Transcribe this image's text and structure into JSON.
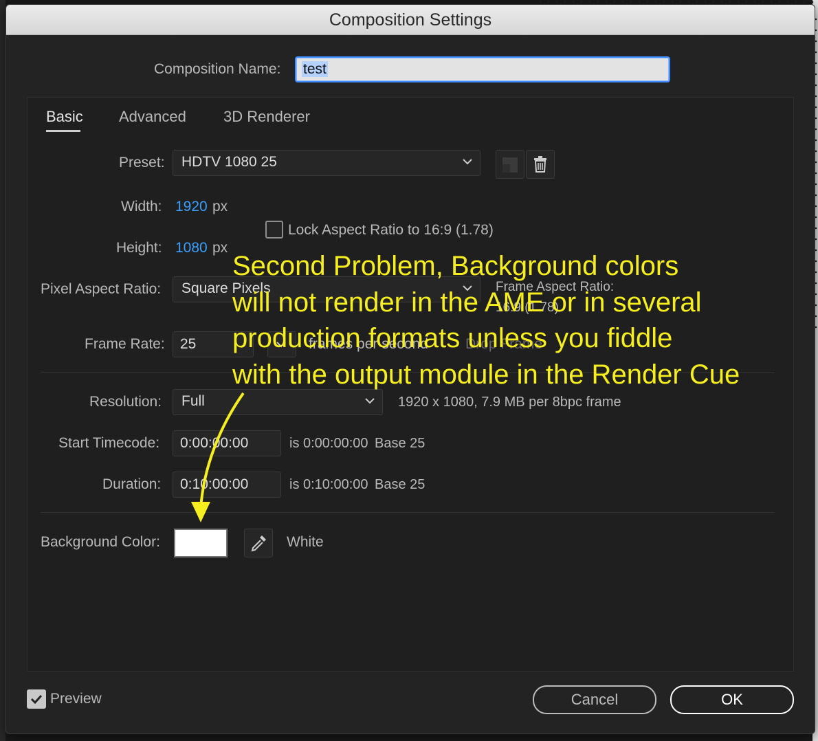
{
  "window": {
    "title": "Composition Settings"
  },
  "composition_name": {
    "label": "Composition Name:",
    "value": "test"
  },
  "tabs": [
    {
      "label": "Basic",
      "active": true
    },
    {
      "label": "Advanced",
      "active": false
    },
    {
      "label": "3D Renderer",
      "active": false
    }
  ],
  "preset": {
    "label": "Preset:",
    "value": "HDTV 1080 25",
    "icons": [
      "save-preset-icon",
      "trash-icon"
    ]
  },
  "width": {
    "label": "Width:",
    "value": "1920",
    "unit": "px"
  },
  "height": {
    "label": "Height:",
    "value": "1080",
    "unit": "px"
  },
  "lock_aspect": {
    "label": "Lock Aspect Ratio to 16:9 (1.78)",
    "checked": false
  },
  "pixel_aspect": {
    "label": "Pixel Aspect Ratio:",
    "value": "Square Pixels"
  },
  "frame_aspect": {
    "label": "Frame Aspect Ratio:",
    "value": "16:9 (1.78)"
  },
  "frame_rate": {
    "label": "Frame Rate:",
    "value": "25",
    "unit_label": "frames per second",
    "drop_frame": "Drop Frame"
  },
  "resolution": {
    "label": "Resolution:",
    "value": "Full",
    "info": "1920 x 1080, 7.9 MB per 8bpc frame"
  },
  "start_timecode": {
    "label": "Start Timecode:",
    "value": "0:00:00:00",
    "is_text": "is 0:00:00:00",
    "base": "Base 25"
  },
  "duration": {
    "label": "Duration:",
    "value": "0:10:00:00",
    "is_text": "is 0:10:00:00",
    "base": "Base 25"
  },
  "background": {
    "label": "Background Color:",
    "color": "#ffffff",
    "name": "White",
    "icon": "eyedropper-icon"
  },
  "preview": {
    "label": "Preview",
    "checked": true
  },
  "buttons": {
    "cancel": "Cancel",
    "ok": "OK"
  },
  "annotation": {
    "lines": [
      "Second Problem, Background colors",
      "will not render in the AME or in several",
      "production formats unless you fiddle",
      "with the output module in the Render Cue"
    ],
    "color": "#f6ee1f"
  }
}
